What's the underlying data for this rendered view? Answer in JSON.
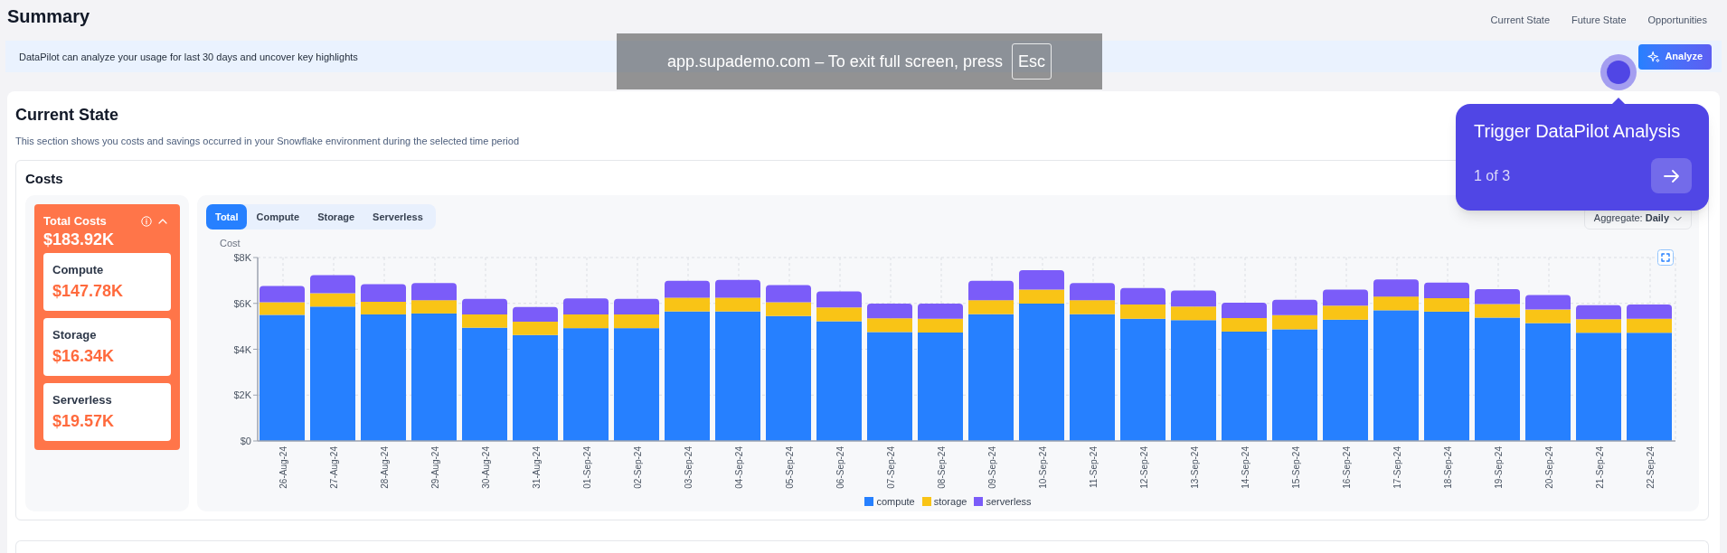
{
  "header": {
    "title": "Summary",
    "nav_links": [
      "Current State",
      "Future State",
      "Opportunities"
    ]
  },
  "banner": {
    "text": "DataPilot can analyze your usage for last 30 days and uncover key highlights",
    "button": "Analyze"
  },
  "fullscreen_notice": {
    "text": "app.supademo.com – To exit full screen, press",
    "key": "Esc"
  },
  "current_state": {
    "title": "Current State",
    "description": "This section shows you costs and savings occurred in your Snowflake environment during the selected time period",
    "costs": {
      "title": "Costs",
      "total": {
        "label": "Total Costs",
        "value": "$183.92K",
        "expanded": true
      },
      "breakdown": [
        {
          "label": "Compute",
          "value": "$147.78K"
        },
        {
          "label": "Storage",
          "value": "$16.34K"
        },
        {
          "label": "Serverless",
          "value": "$19.57K"
        }
      ],
      "tabs": [
        {
          "label": "Total",
          "selected": true
        },
        {
          "label": "Compute",
          "selected": false
        },
        {
          "label": "Storage",
          "selected": false
        },
        {
          "label": "Serverless",
          "selected": false
        }
      ],
      "aggregate": "Aggregate: **Daily**",
      "chart_data": {
        "type": "bar",
        "ylabel": "Cost",
        "stacked": true,
        "grid": true,
        "ylim": [
          0,
          8000
        ],
        "yticks": [
          {
            "value": 0,
            "label": "$0"
          },
          {
            "value": 2000,
            "label": "$2K"
          },
          {
            "value": 4000,
            "label": "$4K"
          },
          {
            "value": 6000,
            "label": "$6K"
          },
          {
            "value": 8000,
            "label": "$8K"
          }
        ],
        "categories": [
          "26-Aug-24",
          "27-Aug-24",
          "28-Aug-24",
          "29-Aug-24",
          "30-Aug-24",
          "31-Aug-24",
          "01-Sep-24",
          "02-Sep-24",
          "03-Sep-24",
          "04-Sep-24",
          "05-Sep-24",
          "06-Sep-24",
          "07-Sep-24",
          "08-Sep-24",
          "09-Sep-24",
          "10-Sep-24",
          "11-Sep-24",
          "12-Sep-24",
          "13-Sep-24",
          "14-Sep-24",
          "15-Sep-24",
          "16-Sep-24",
          "17-Sep-24",
          "18-Sep-24",
          "19-Sep-24",
          "20-Sep-24",
          "21-Sep-24",
          "22-Sep-24"
        ],
        "series": [
          {
            "name": "compute",
            "color": "#2680ff",
            "values": [
              5500,
              5860,
              5520,
              5560,
              4940,
              4620,
              4920,
              4920,
              5650,
              5650,
              5450,
              5220,
              4750,
              4730,
              5530,
              5990,
              5530,
              5330,
              5270,
              4770,
              4870,
              5290,
              5700,
              5640,
              5380,
              5140,
              4720,
              4720
            ]
          },
          {
            "name": "storage",
            "color": "#f9c416",
            "values": [
              550,
              580,
              550,
              580,
              580,
              580,
              600,
              600,
              600,
              600,
              600,
              600,
              600,
              600,
              610,
              610,
              610,
              620,
              590,
              590,
              620,
              610,
              600,
              590,
              590,
              590,
              590,
              610
            ]
          },
          {
            "name": "serverless",
            "color": "#7b5cf9",
            "values": [
              710,
              790,
              770,
              750,
              680,
              640,
              700,
              680,
              740,
              770,
              750,
              700,
              640,
              660,
              850,
              850,
              750,
              720,
              700,
              670,
              670,
              700,
              740,
              680,
              650,
              630,
              610,
              620
            ]
          }
        ]
      }
    }
  },
  "tour": {
    "title": "Trigger DataPilot Analysis",
    "step": "1 of 3"
  }
}
